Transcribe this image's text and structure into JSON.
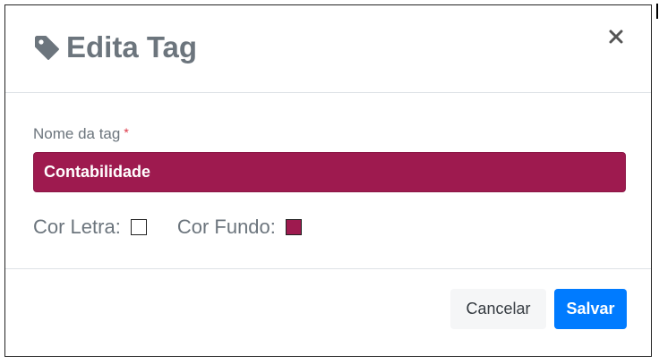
{
  "modal": {
    "title": "Edita Tag",
    "title_icon": "tag-icon",
    "close_icon": "close-icon"
  },
  "form": {
    "name_label": "Nome da tag",
    "required_marker": "*",
    "name_value": "Contabilidade",
    "text_color_label": "Cor Letra:",
    "text_color": "#ffffff",
    "bg_color_label": "Cor Fundo:",
    "bg_color": "#9e1a4f"
  },
  "footer": {
    "cancel_label": "Cancelar",
    "save_label": "Salvar"
  },
  "colors": {
    "primary": "#007bff",
    "title_gray": "#6c757d",
    "tag_background": "#9e1a4f"
  }
}
